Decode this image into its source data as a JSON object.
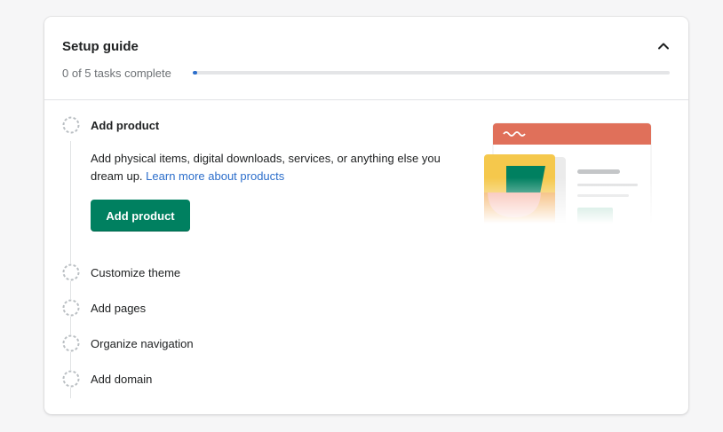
{
  "setup_guide": {
    "title": "Setup guide",
    "progress_text": "0 of 5 tasks complete",
    "progress_fraction": 0.01,
    "collapse_icon": "chevron-up-icon"
  },
  "tasks": [
    {
      "label": "Add product",
      "active": true,
      "description": "Add physical items, digital downloads, services, or anything else you dream up.",
      "link_text": "Learn more about products",
      "button_label": "Add product"
    },
    {
      "label": "Customize theme",
      "active": false
    },
    {
      "label": "Add pages",
      "active": false
    },
    {
      "label": "Organize navigation",
      "active": false
    },
    {
      "label": "Add domain",
      "active": false
    }
  ],
  "colors": {
    "primary_button": "#008060",
    "link": "#2c6ecb",
    "progress_fill": "#2c6ecb"
  }
}
